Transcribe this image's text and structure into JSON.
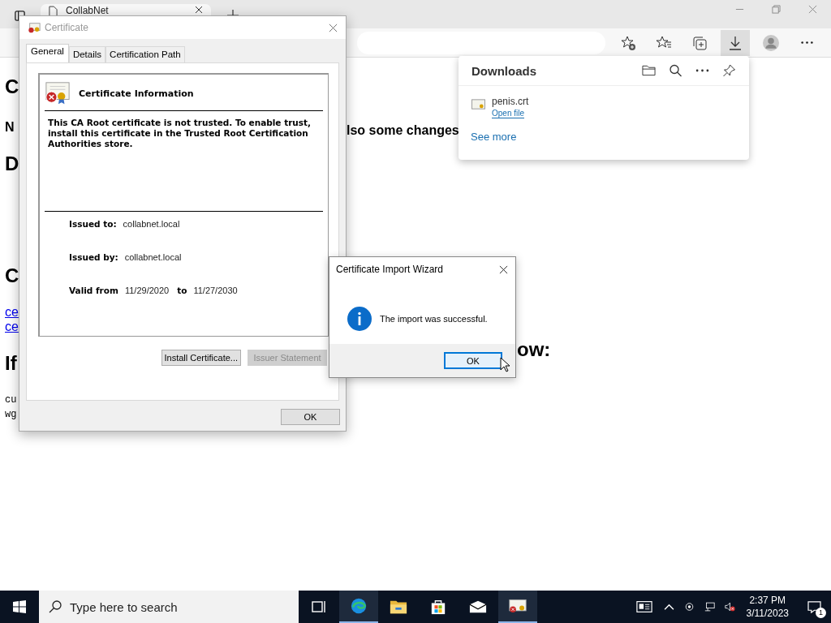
{
  "browser": {
    "tab": {
      "title": "CollabNet"
    },
    "toolbar": [
      {
        "kind": "favorite-add",
        "selected": false
      },
      {
        "kind": "favorites",
        "selected": false
      },
      {
        "kind": "collections",
        "selected": false
      },
      {
        "kind": "downloads",
        "selected": true
      },
      {
        "kind": "profile",
        "selected": false
      },
      {
        "kind": "more",
        "selected": false
      }
    ]
  },
  "page": {
    "left": [
      {
        "text": "C",
        "kind": "h1"
      },
      {
        "text": "N",
        "kind": "bold"
      },
      {
        "text": "D",
        "kind": "h2"
      },
      {
        "text": "C",
        "kind": "h2"
      },
      {
        "text": "ce",
        "kind": "link"
      },
      {
        "text": "ce",
        "kind": "link"
      },
      {
        "text": "If",
        "kind": "h2"
      },
      {
        "text": "cu",
        "kind": "code"
      },
      {
        "text": "wg",
        "kind": "code"
      }
    ],
    "right": [
      {
        "text": "lso some changes",
        "kind": "bold"
      },
      {
        "text": "ow:",
        "kind": "h2"
      }
    ]
  },
  "downloads": {
    "title": "Downloads",
    "items": [
      {
        "name": "penis.crt",
        "action": "Open file"
      }
    ],
    "see_more": "See more"
  },
  "certificate_dialog": {
    "title": "Certificate",
    "tabs": [
      {
        "label": "General",
        "selected": true
      },
      {
        "label": "Details",
        "selected": false
      },
      {
        "label": "Certification Path",
        "selected": false
      }
    ],
    "info_title": "Certificate Information",
    "message": "This CA Root certificate is not trusted. To enable trust, install this certificate in the Trusted Root Certification Authorities store.",
    "issued_to_label": "Issued to:",
    "issued_to": "collabnet.local",
    "issued_by_label": "Issued by:",
    "issued_by": "collabnet.local",
    "valid_from_label": "Valid from",
    "valid_from": "11/29/2020",
    "to_label": "to",
    "valid_to": "11/27/2030",
    "buttons": [
      {
        "label": "Install Certificate...",
        "disabled": false
      },
      {
        "label": "Issuer Statement",
        "disabled": true
      }
    ],
    "ok": "OK"
  },
  "wizard": {
    "title": "Certificate Import Wizard",
    "message": "The import was successful.",
    "ok": {
      "label": "OK",
      "focused": true
    }
  },
  "taskbar": {
    "search_placeholder": "Type here to search",
    "apps": [
      {
        "kind": "task-view",
        "active": false
      },
      {
        "kind": "browser",
        "active": true
      },
      {
        "kind": "folder",
        "active": false
      },
      {
        "kind": "store",
        "active": false
      },
      {
        "kind": "mail",
        "active": false
      },
      {
        "kind": "certificate",
        "active": true
      }
    ],
    "time": "2:37 PM",
    "date": "3/11/2023",
    "notifications": "1"
  }
}
